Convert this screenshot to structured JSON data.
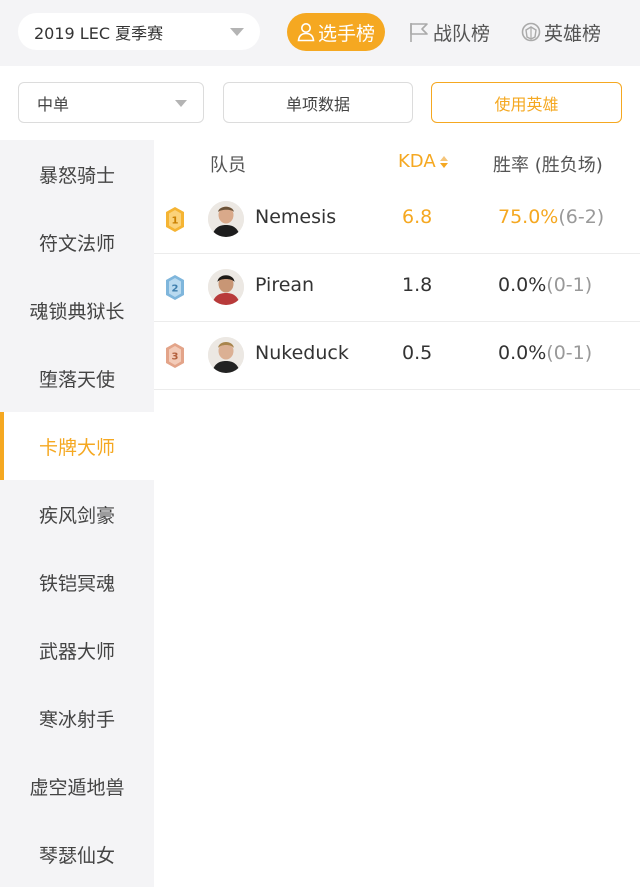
{
  "header": {
    "season": "2019 LEC 夏季赛",
    "tabs": [
      {
        "label": "选手榜",
        "icon": "person-icon",
        "active": true
      },
      {
        "label": "战队榜",
        "icon": "flag-icon",
        "active": false
      },
      {
        "label": "英雄榜",
        "icon": "champion-helmet-icon",
        "active": false
      }
    ]
  },
  "filters": {
    "position": "中单",
    "single_stats": "单项数据",
    "use_hero": "使用英雄"
  },
  "sidebar": {
    "items": [
      {
        "label": "暴怒骑士"
      },
      {
        "label": "符文法师"
      },
      {
        "label": "魂锁典狱长"
      },
      {
        "label": "堕落天使"
      },
      {
        "label": "卡牌大师",
        "active": true
      },
      {
        "label": "疾风剑豪"
      },
      {
        "label": "铁铠冥魂"
      },
      {
        "label": "武器大师"
      },
      {
        "label": "寒冰射手"
      },
      {
        "label": "虚空遁地兽"
      },
      {
        "label": "琴瑟仙女"
      }
    ]
  },
  "table": {
    "headers": {
      "player": "队员",
      "kda": "KDA",
      "win_rate": "胜率 (胜负场)"
    },
    "rows": [
      {
        "rank": "1",
        "name": "Nemesis",
        "kda": "6.8",
        "win_rate": "75.0%",
        "record": "(6-2)",
        "rank_color": "#f5b433"
      },
      {
        "rank": "2",
        "name": "Pirean",
        "kda": "1.8",
        "win_rate": "0.0%",
        "record": "(0-1)",
        "rank_color": "#7fb6dc"
      },
      {
        "rank": "3",
        "name": "Nukeduck",
        "kda": "0.5",
        "win_rate": "0.0%",
        "record": "(0-1)",
        "rank_color": "#e3a489"
      }
    ]
  },
  "colors": {
    "accent": "#f5a821",
    "sidebar_bg": "#f4f4f6"
  }
}
